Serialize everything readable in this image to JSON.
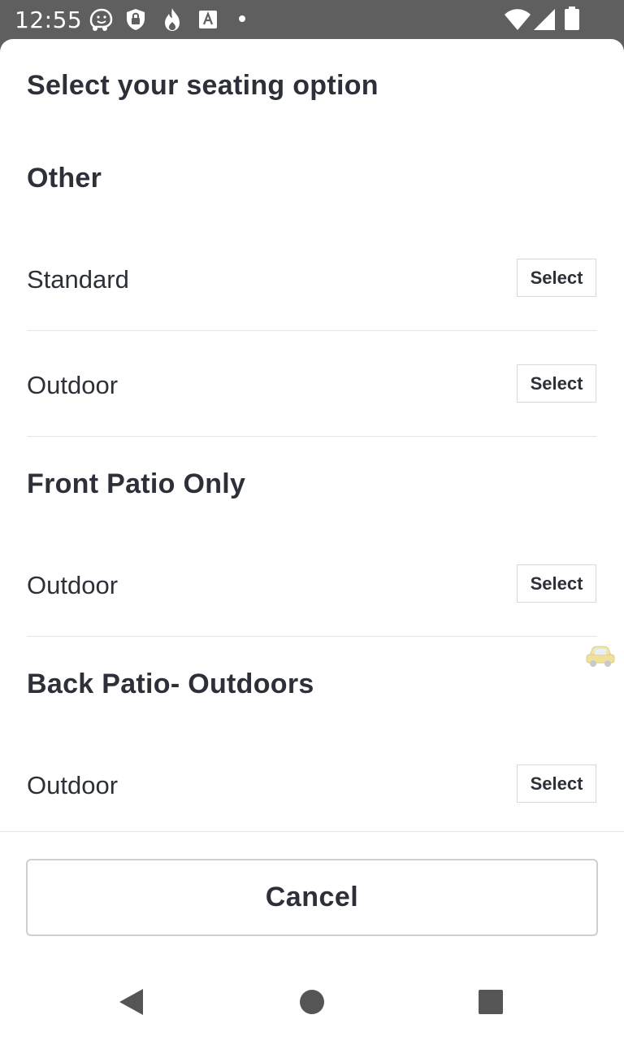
{
  "status_bar": {
    "time": "12:55",
    "left_icons": [
      "waze-icon",
      "shield-lock-icon",
      "flame-icon",
      "font-a-icon",
      "dot-icon"
    ],
    "right_icons": [
      "wifi-icon",
      "signal-icon",
      "battery-icon"
    ]
  },
  "sheet": {
    "title": "Select your seating option",
    "sections": [
      {
        "heading": "Other",
        "rows": [
          {
            "label": "Standard",
            "button": "Select"
          },
          {
            "label": "Outdoor",
            "button": "Select"
          }
        ]
      },
      {
        "heading": "Front Patio Only",
        "rows": [
          {
            "label": "Outdoor",
            "button": "Select"
          }
        ]
      },
      {
        "heading": "Back Patio- Outdoors",
        "rows": [
          {
            "label": "Outdoor",
            "button": "Select"
          }
        ]
      }
    ],
    "cancel_label": "Cancel"
  },
  "nav": {
    "icons": [
      "back-icon",
      "home-icon",
      "recents-icon"
    ]
  },
  "colors": {
    "text": "#2d3039",
    "status_bar": "#5f5f5f",
    "divider": "#e6e6e6"
  }
}
